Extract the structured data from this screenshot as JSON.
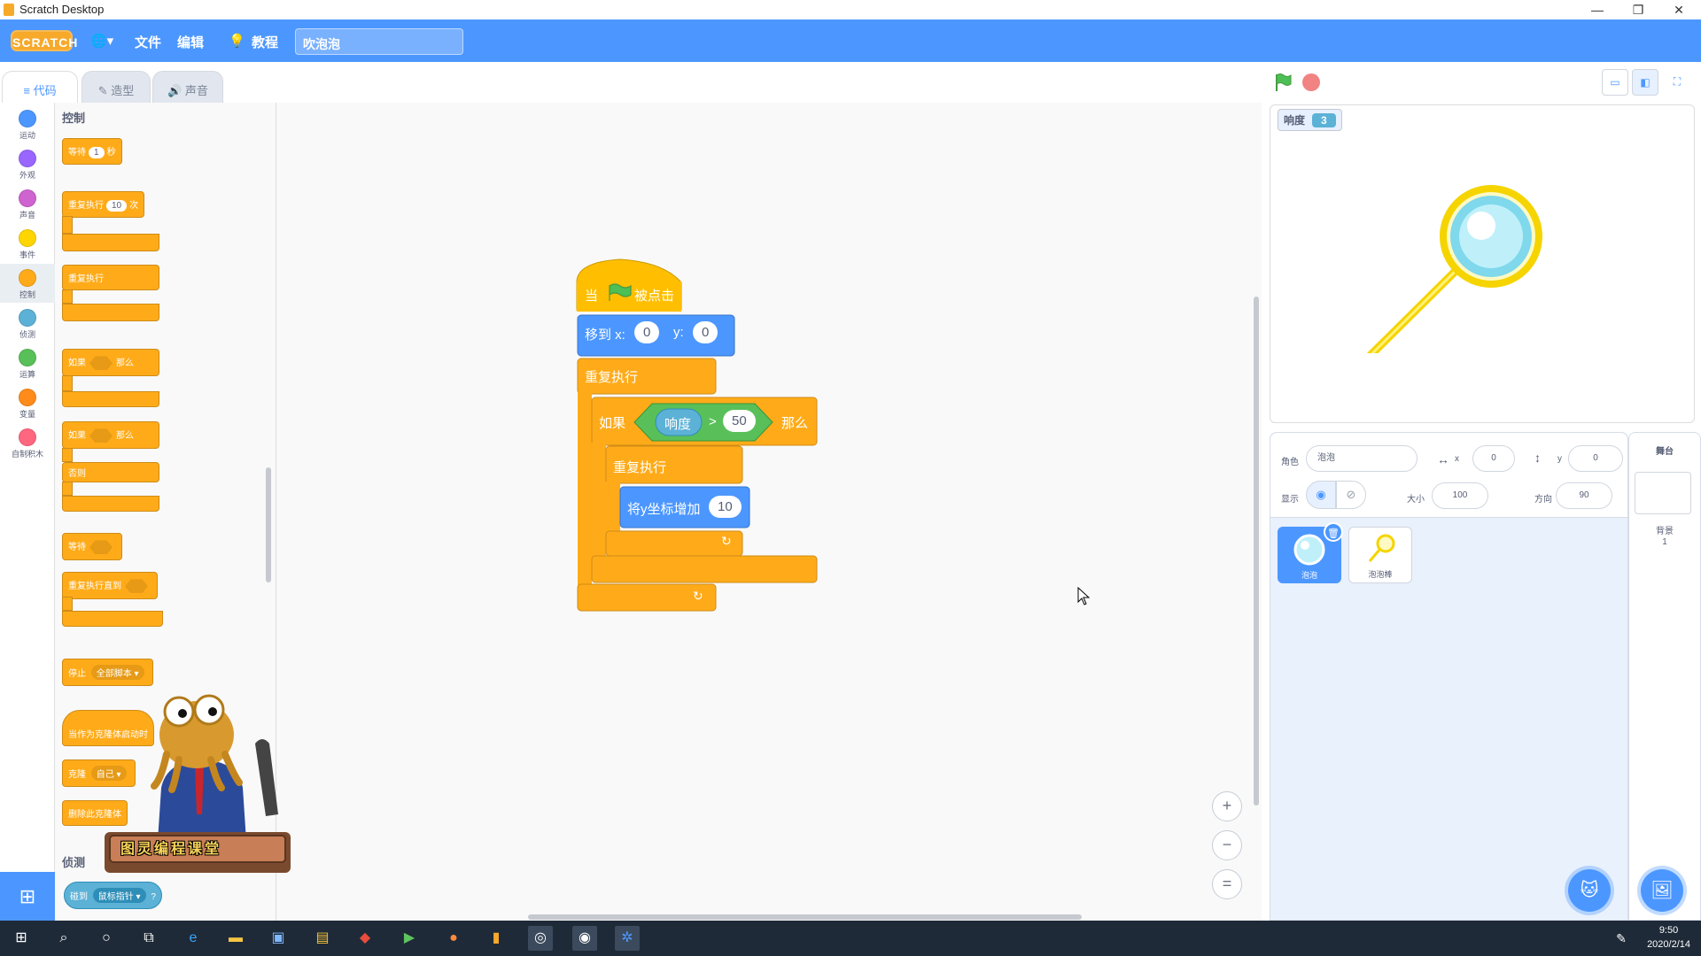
{
  "window": {
    "title": "Scratch Desktop",
    "min": "—",
    "max": "❐",
    "close": "✕"
  },
  "menubar": {
    "logo": "SCRATCH",
    "language_icon": "🌐▾",
    "file": "文件",
    "edit": "编辑",
    "tutorials": "教程",
    "project_title": "吹泡泡"
  },
  "tabs": [
    {
      "label": "代码",
      "icon": "≡"
    },
    {
      "label": "造型",
      "icon": "✎"
    },
    {
      "label": "声音",
      "icon": "🔊"
    }
  ],
  "categories": [
    {
      "label": "运动",
      "color": "#4c97ff"
    },
    {
      "label": "外观",
      "color": "#9966ff"
    },
    {
      "label": "声音",
      "color": "#cf63cf"
    },
    {
      "label": "事件",
      "color": "#ffd500"
    },
    {
      "label": "控制",
      "color": "#ffab19"
    },
    {
      "label": "侦测",
      "color": "#5cb1d6"
    },
    {
      "label": "运算",
      "color": "#59c059"
    },
    {
      "label": "变量",
      "color": "#ff8c1a"
    },
    {
      "label": "自制积木",
      "color": "#ff6680"
    }
  ],
  "flyout": {
    "control_header": "控制",
    "wait_label": "等待",
    "wait_value": "1",
    "wait_unit": "秒",
    "repeat_label": "重复执行",
    "repeat_value": "10",
    "repeat_unit": "次",
    "forever_label": "重复执行",
    "if_label": "如果",
    "then_label": "那么",
    "if2_label": "如果",
    "then2_label": "那么",
    "else_label": "否则",
    "wait_until_label": "等待",
    "repeat_until_label": "重复执行直到",
    "stop_label": "停止",
    "stop_option": "全部脚本 ▾",
    "clone_hat_label": "当作为克隆体启动时",
    "clone_label": "克隆",
    "clone_option": "自己 ▾",
    "delete_clone_label": "删除此克隆体",
    "sensing_header": "侦测",
    "touching_label": "碰到",
    "touching_option": "鼠标指针 ▾",
    "touching_q": "?"
  },
  "mascot": {
    "caption": "图灵编程课堂"
  },
  "script": {
    "hat_when": "当",
    "hat_clicked": "被点击",
    "goto_label": "移到 x:",
    "goto_x": "0",
    "goto_y_label": "y:",
    "goto_y": "0",
    "forever_label": "重复执行",
    "if_label": "如果",
    "loudness_label": "响度",
    "gt": ">",
    "threshold": "50",
    "then_label": "那么",
    "inner_forever_label": "重复执行",
    "change_y_label": "将y坐标增加",
    "change_y_value": "10",
    "loop_arrow": "↻"
  },
  "zoom": {
    "in": "+",
    "out": "−",
    "reset": "="
  },
  "stage": {
    "monitor_label": "响度",
    "monitor_value": "3"
  },
  "sprite_info": {
    "sprite_label": "角色",
    "sprite_name": "泡泡",
    "x_label": "x",
    "x_value": "0",
    "y_label": "y",
    "y_value": "0",
    "show_label": "显示",
    "size_label": "大小",
    "size_value": "100",
    "direction_label": "方向",
    "direction_value": "90"
  },
  "sprites": [
    {
      "name": "泡泡"
    },
    {
      "name": "泡泡棒"
    }
  ],
  "backdrop": {
    "header": "舞台",
    "label": "背景",
    "count": "1"
  },
  "taskbar": {
    "time": "9:50",
    "date": "2020/2/14"
  }
}
